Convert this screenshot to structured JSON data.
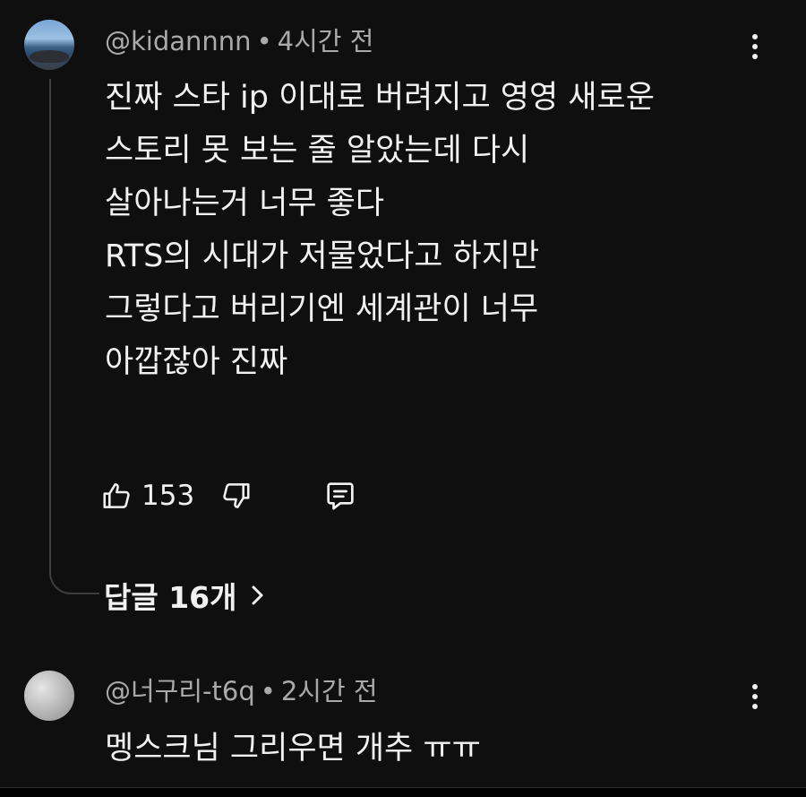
{
  "comments": [
    {
      "author": "@kidannnn",
      "time": "4시간 전",
      "separator": "•",
      "lines": [
        "진짜 스타 ip 이대로 버려지고 영영 새로운",
        "스토리 못 보는 줄 알았는데 다시",
        "살아나는거 너무 좋다",
        "RTS의 시대가 저물었다고 하지만",
        "그렇다고 버리기엔 세계관이 너무",
        "아깝잖아 진짜"
      ],
      "likes": "153",
      "replies_label": "답글 16개"
    },
    {
      "author": "@너구리-t6q",
      "time": "2시간 전",
      "separator": "•",
      "lines": [
        "멩스크님 그리우면 개추 ㅠㅠ"
      ]
    }
  ],
  "icons": {
    "like": "thumbs-up-icon",
    "dislike": "thumbs-down-icon",
    "reply": "comment-reply-icon",
    "more": "more-vertical-icon",
    "expand": "chevron-right-icon"
  },
  "colors": {
    "background": "#0f0f0f",
    "text": "#f1f1f1",
    "meta": "#aaaaaa",
    "thread_line": "#3d3d3d"
  }
}
